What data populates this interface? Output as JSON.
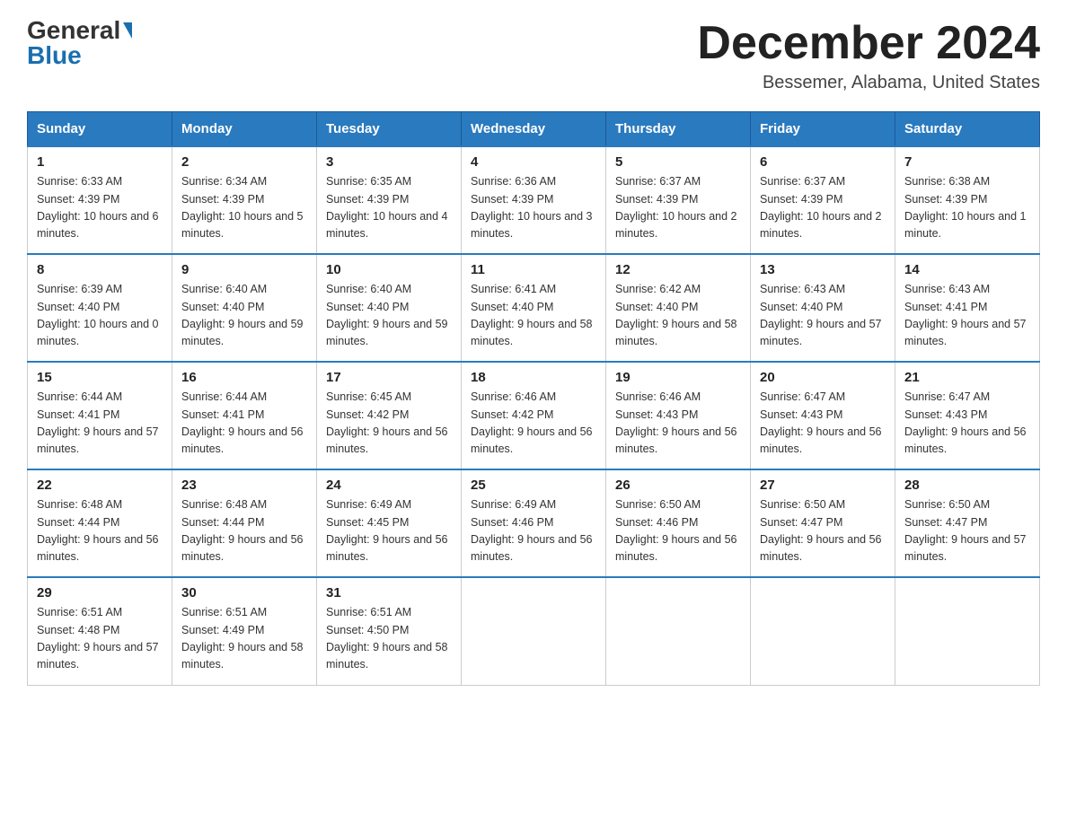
{
  "header": {
    "logo_general": "General",
    "logo_blue": "Blue",
    "title": "December 2024",
    "subtitle": "Bessemer, Alabama, United States"
  },
  "weekdays": [
    "Sunday",
    "Monday",
    "Tuesday",
    "Wednesday",
    "Thursday",
    "Friday",
    "Saturday"
  ],
  "weeks": [
    [
      {
        "day": "1",
        "sunrise": "6:33 AM",
        "sunset": "4:39 PM",
        "daylight": "10 hours and 6 minutes."
      },
      {
        "day": "2",
        "sunrise": "6:34 AM",
        "sunset": "4:39 PM",
        "daylight": "10 hours and 5 minutes."
      },
      {
        "day": "3",
        "sunrise": "6:35 AM",
        "sunset": "4:39 PM",
        "daylight": "10 hours and 4 minutes."
      },
      {
        "day": "4",
        "sunrise": "6:36 AM",
        "sunset": "4:39 PM",
        "daylight": "10 hours and 3 minutes."
      },
      {
        "day": "5",
        "sunrise": "6:37 AM",
        "sunset": "4:39 PM",
        "daylight": "10 hours and 2 minutes."
      },
      {
        "day": "6",
        "sunrise": "6:37 AM",
        "sunset": "4:39 PM",
        "daylight": "10 hours and 2 minutes."
      },
      {
        "day": "7",
        "sunrise": "6:38 AM",
        "sunset": "4:39 PM",
        "daylight": "10 hours and 1 minute."
      }
    ],
    [
      {
        "day": "8",
        "sunrise": "6:39 AM",
        "sunset": "4:40 PM",
        "daylight": "10 hours and 0 minutes."
      },
      {
        "day": "9",
        "sunrise": "6:40 AM",
        "sunset": "4:40 PM",
        "daylight": "9 hours and 59 minutes."
      },
      {
        "day": "10",
        "sunrise": "6:40 AM",
        "sunset": "4:40 PM",
        "daylight": "9 hours and 59 minutes."
      },
      {
        "day": "11",
        "sunrise": "6:41 AM",
        "sunset": "4:40 PM",
        "daylight": "9 hours and 58 minutes."
      },
      {
        "day": "12",
        "sunrise": "6:42 AM",
        "sunset": "4:40 PM",
        "daylight": "9 hours and 58 minutes."
      },
      {
        "day": "13",
        "sunrise": "6:43 AM",
        "sunset": "4:40 PM",
        "daylight": "9 hours and 57 minutes."
      },
      {
        "day": "14",
        "sunrise": "6:43 AM",
        "sunset": "4:41 PM",
        "daylight": "9 hours and 57 minutes."
      }
    ],
    [
      {
        "day": "15",
        "sunrise": "6:44 AM",
        "sunset": "4:41 PM",
        "daylight": "9 hours and 57 minutes."
      },
      {
        "day": "16",
        "sunrise": "6:44 AM",
        "sunset": "4:41 PM",
        "daylight": "9 hours and 56 minutes."
      },
      {
        "day": "17",
        "sunrise": "6:45 AM",
        "sunset": "4:42 PM",
        "daylight": "9 hours and 56 minutes."
      },
      {
        "day": "18",
        "sunrise": "6:46 AM",
        "sunset": "4:42 PM",
        "daylight": "9 hours and 56 minutes."
      },
      {
        "day": "19",
        "sunrise": "6:46 AM",
        "sunset": "4:43 PM",
        "daylight": "9 hours and 56 minutes."
      },
      {
        "day": "20",
        "sunrise": "6:47 AM",
        "sunset": "4:43 PM",
        "daylight": "9 hours and 56 minutes."
      },
      {
        "day": "21",
        "sunrise": "6:47 AM",
        "sunset": "4:43 PM",
        "daylight": "9 hours and 56 minutes."
      }
    ],
    [
      {
        "day": "22",
        "sunrise": "6:48 AM",
        "sunset": "4:44 PM",
        "daylight": "9 hours and 56 minutes."
      },
      {
        "day": "23",
        "sunrise": "6:48 AM",
        "sunset": "4:44 PM",
        "daylight": "9 hours and 56 minutes."
      },
      {
        "day": "24",
        "sunrise": "6:49 AM",
        "sunset": "4:45 PM",
        "daylight": "9 hours and 56 minutes."
      },
      {
        "day": "25",
        "sunrise": "6:49 AM",
        "sunset": "4:46 PM",
        "daylight": "9 hours and 56 minutes."
      },
      {
        "day": "26",
        "sunrise": "6:50 AM",
        "sunset": "4:46 PM",
        "daylight": "9 hours and 56 minutes."
      },
      {
        "day": "27",
        "sunrise": "6:50 AM",
        "sunset": "4:47 PM",
        "daylight": "9 hours and 56 minutes."
      },
      {
        "day": "28",
        "sunrise": "6:50 AM",
        "sunset": "4:47 PM",
        "daylight": "9 hours and 57 minutes."
      }
    ],
    [
      {
        "day": "29",
        "sunrise": "6:51 AM",
        "sunset": "4:48 PM",
        "daylight": "9 hours and 57 minutes."
      },
      {
        "day": "30",
        "sunrise": "6:51 AM",
        "sunset": "4:49 PM",
        "daylight": "9 hours and 58 minutes."
      },
      {
        "day": "31",
        "sunrise": "6:51 AM",
        "sunset": "4:50 PM",
        "daylight": "9 hours and 58 minutes."
      },
      null,
      null,
      null,
      null
    ]
  ]
}
